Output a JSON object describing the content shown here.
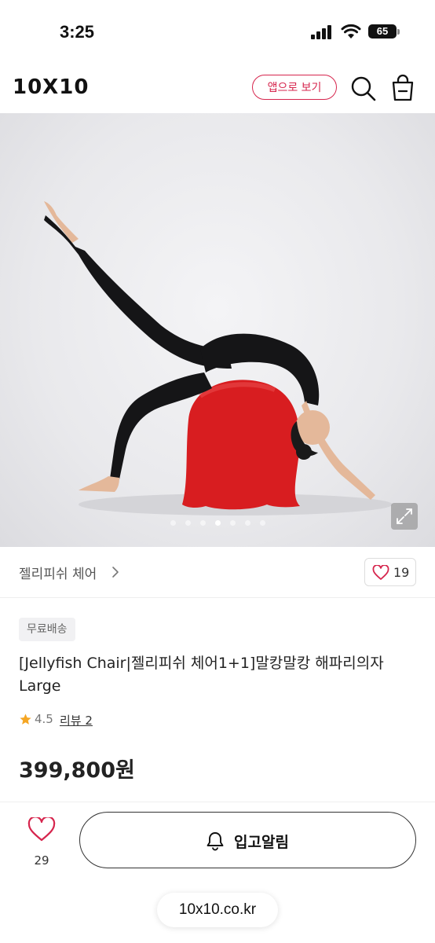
{
  "status_bar": {
    "time": "3:25",
    "battery": "65"
  },
  "header": {
    "logo": "10X10",
    "app_button": "앱으로 보기",
    "icons": [
      "search-icon",
      "shopping-bag-icon"
    ]
  },
  "gallery": {
    "slide_count": 7,
    "active_index": 3,
    "expand_icon": "expand-icon"
  },
  "product": {
    "brand": "젤리피쉬 체어",
    "like_count": "19",
    "badge": "무료배송",
    "title": "[Jellyfish Chair|젤리피쉬 체어1+1]말캉말캉 해파리의자 Large",
    "rating": "4.5",
    "review_label": "리뷰 2",
    "price": "399,800원"
  },
  "bottom_bar": {
    "wish_count": "29",
    "notify_label": "입고알림"
  },
  "browser": {
    "url": "10x10.co.kr"
  },
  "colors": {
    "accent": "#d6254d",
    "text": "#222222",
    "star": "#f5a623"
  }
}
